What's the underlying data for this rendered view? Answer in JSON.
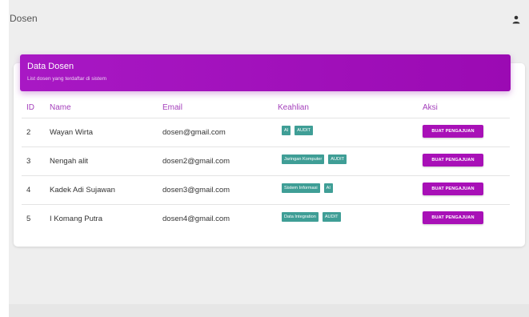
{
  "app": {
    "title": "Dosen"
  },
  "colors": {
    "header": "#a818c4",
    "accent": "#a43fbb",
    "badge": "#3f9e96",
    "button": "#a810b7"
  },
  "card": {
    "title": "Data Dosen",
    "subtitle": "List dosen yang terdaftar di sistem"
  },
  "table": {
    "headers": {
      "id": "ID",
      "name": "Name",
      "email": "Email",
      "skill": "Keahlian",
      "action": "Aksi"
    },
    "rows": [
      {
        "id": "2",
        "name": "Wayan Wirta",
        "email": "dosen@gmail.com",
        "skills": [
          "AI",
          "AUDIT"
        ],
        "action": "BUAT PENGAJUAN"
      },
      {
        "id": "3",
        "name": "Nengah alit",
        "email": "dosen2@gmail.com",
        "skills": [
          "Jaringan Komputer",
          "AUDIT"
        ],
        "action": "BUAT PENGAJUAN"
      },
      {
        "id": "4",
        "name": "Kadek Adi Sujawan",
        "email": "dosen3@gmail.com",
        "skills": [
          "Sistem Informasi",
          "AI"
        ],
        "action": "BUAT PENGAJUAN"
      },
      {
        "id": "5",
        "name": "I Komang Putra",
        "email": "dosen4@gmail.com",
        "skills": [
          "Data Integration",
          "AUDIT"
        ],
        "action": "BUAT PENGAJUAN"
      }
    ]
  },
  "icons": {
    "user": "user-icon"
  }
}
